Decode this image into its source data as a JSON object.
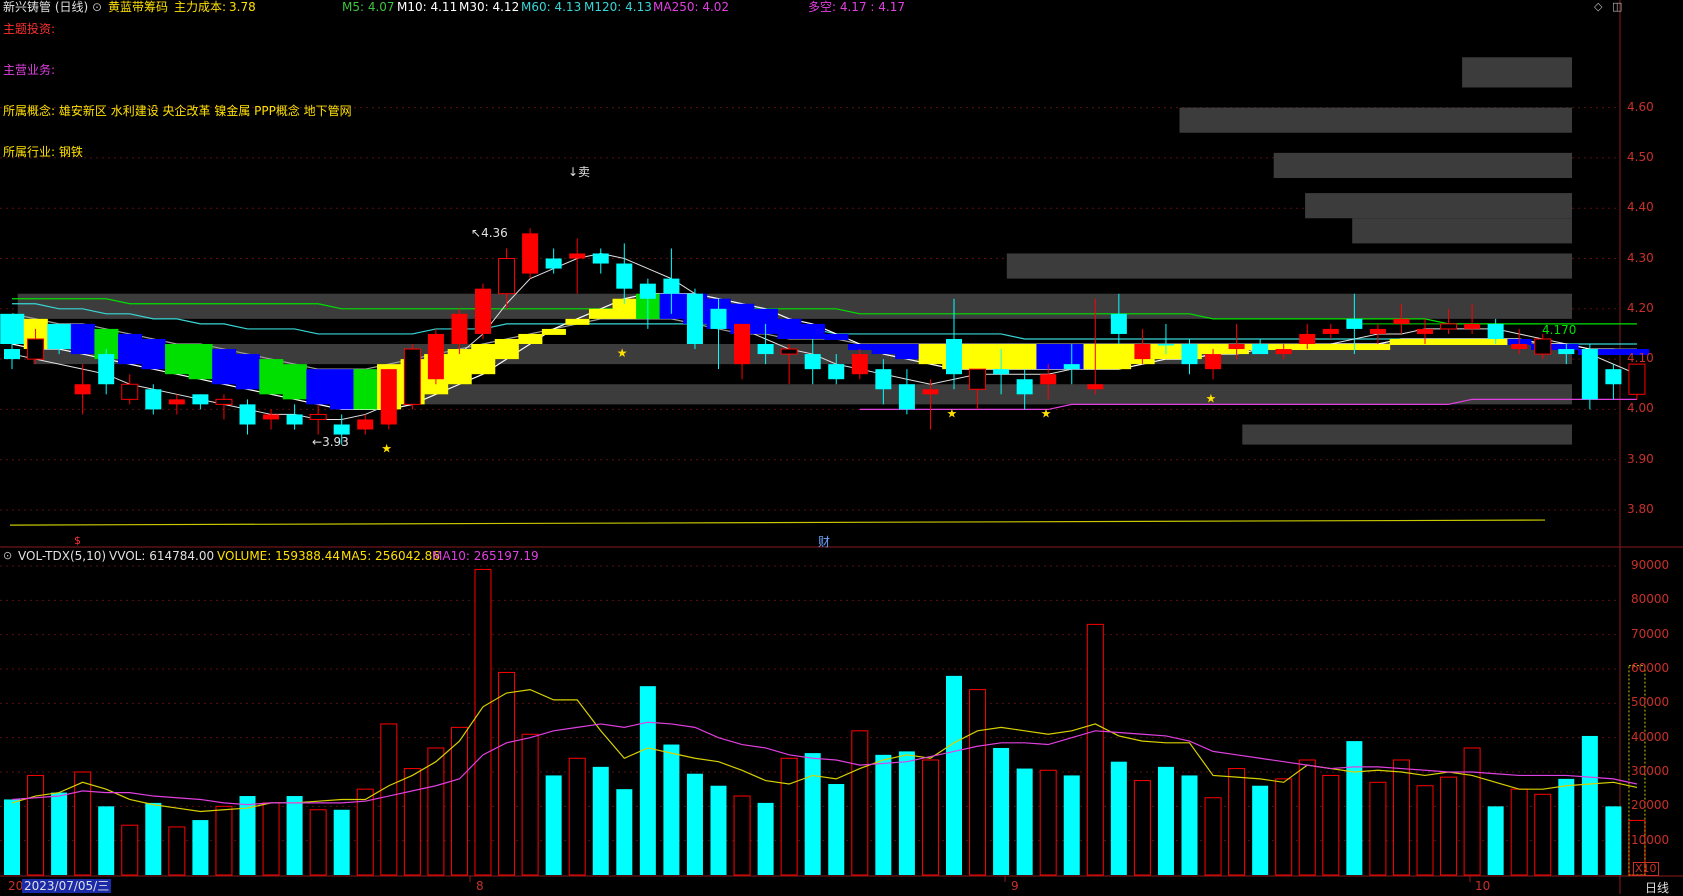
{
  "header": {
    "title": "新兴铸管 (日线)",
    "indicator_name": "黄蓝带筹码",
    "main_cost_label": "主力成本: ",
    "main_cost_value": "3.78",
    "ma": [
      {
        "label": "M5: 4.07",
        "color": "#3fc23f"
      },
      {
        "label": "M10: 4.11",
        "color": "#ffffff"
      },
      {
        "label": "M30: 4.12",
        "color": "#ffffff"
      },
      {
        "label": "M60: 4.13",
        "color": "#38d6d6"
      },
      {
        "label": "M120: 4.13",
        "color": "#38d6d6"
      },
      {
        "label": "MA250: 4.02",
        "color": "#e040e0"
      }
    ],
    "duokong": "多空: 4.17 : 4.17"
  },
  "info": {
    "theme_invest": "主题投资:",
    "main_business": "主营业务:",
    "concepts_label": "所属概念:",
    "concepts": "雄安新区 水利建设 央企改革 镍金属 PPP概念 地下管网",
    "industry_label": "所属行业:",
    "industry": "钢铁"
  },
  "annotations": {
    "high": "4.36",
    "low": "3.93",
    "sell": "↓卖",
    "last_line_value": "4.170",
    "finance_marker": "财",
    "dividend_marker": "$"
  },
  "volume_panel": {
    "name": "VOL-TDX(5,10)",
    "vvol": "VVOL: 614784.00",
    "volume": "VOLUME: 159388.44",
    "ma5": "MA5: 256042.86",
    "ma10": "MA10: 265197.19",
    "multiplier": "X10"
  },
  "footer": {
    "start_fragment": "20",
    "date": "2023/07/05/三",
    "month_8": "8",
    "month_9": "9",
    "month_10": "10",
    "period": "日线"
  },
  "colors": {
    "up": "#ff0000",
    "down": "#00ffff",
    "yellow": "#ffff00",
    "green": "#00e000",
    "blue": "#0000ff",
    "magenta": "#e040e0",
    "grid": "#5a1010",
    "axis_text": "#c8302a"
  },
  "chart_data": {
    "type": "candlestick",
    "price_axis": {
      "ticks": [
        3.8,
        3.9,
        4.0,
        4.1,
        4.2,
        4.3,
        4.4,
        4.5,
        4.6
      ],
      "ylim": [
        3.74,
        4.68
      ]
    },
    "volume_axis": {
      "ticks": [
        10000,
        20000,
        30000,
        40000,
        50000,
        60000,
        70000,
        80000,
        90000
      ],
      "ylim": [
        0,
        95000
      ],
      "multiplier": 10
    },
    "candles": [
      [
        4.12,
        4.13,
        4.08,
        4.1,
        "dn",
        22000
      ],
      [
        4.1,
        4.16,
        4.09,
        4.14,
        "up",
        29000
      ],
      [
        4.14,
        4.15,
        4.11,
        4.12,
        "dn",
        24000
      ],
      [
        4.05,
        4.09,
        3.99,
        4.03,
        "up",
        30000
      ],
      [
        4.11,
        4.12,
        4.03,
        4.05,
        "dn",
        20000
      ],
      [
        4.05,
        4.07,
        4.01,
        4.02,
        "up",
        14500
      ],
      [
        4.04,
        4.05,
        3.99,
        4.0,
        "dn",
        21000
      ],
      [
        4.01,
        4.03,
        3.99,
        4.02,
        "up",
        14000
      ],
      [
        4.03,
        4.03,
        4.0,
        4.01,
        "dn",
        16000
      ],
      [
        4.01,
        4.03,
        3.98,
        4.02,
        "up",
        20000
      ],
      [
        4.01,
        4.02,
        3.95,
        3.97,
        "dn",
        23000
      ],
      [
        3.98,
        4.0,
        3.96,
        3.99,
        "up",
        21000
      ],
      [
        3.99,
        4.01,
        3.96,
        3.97,
        "dn",
        23000
      ],
      [
        3.98,
        4.01,
        3.95,
        3.99,
        "up",
        19000
      ],
      [
        3.97,
        3.99,
        3.93,
        3.95,
        "dn",
        19000
      ],
      [
        3.96,
        3.99,
        3.95,
        3.98,
        "up",
        25000
      ],
      [
        3.97,
        4.08,
        3.96,
        4.08,
        "up",
        44000
      ],
      [
        4.01,
        4.13,
        4.0,
        4.12,
        "up",
        31000
      ],
      [
        4.06,
        4.16,
        4.05,
        4.15,
        "up",
        37000
      ],
      [
        4.13,
        4.2,
        4.11,
        4.19,
        "up",
        43000
      ],
      [
        4.15,
        4.25,
        4.14,
        4.24,
        "up",
        89000
      ],
      [
        4.23,
        4.32,
        4.2,
        4.3,
        "up",
        59000
      ],
      [
        4.27,
        4.36,
        4.26,
        4.35,
        "up",
        41000
      ],
      [
        4.3,
        4.32,
        4.27,
        4.28,
        "dn",
        29000
      ],
      [
        4.3,
        4.34,
        4.23,
        4.31,
        "up",
        34000
      ],
      [
        4.31,
        4.32,
        4.27,
        4.29,
        "dn",
        31500
      ],
      [
        4.29,
        4.33,
        4.21,
        4.24,
        "dn",
        25000
      ],
      [
        4.25,
        4.26,
        4.16,
        4.22,
        "dn",
        55000
      ],
      [
        4.26,
        4.32,
        4.19,
        4.23,
        "dn",
        38000
      ],
      [
        4.23,
        4.24,
        4.12,
        4.13,
        "dn",
        29500
      ],
      [
        4.2,
        4.22,
        4.08,
        4.16,
        "dn",
        26000
      ],
      [
        4.17,
        4.17,
        4.06,
        4.09,
        "up",
        23000
      ],
      [
        4.13,
        4.17,
        4.09,
        4.11,
        "dn",
        21000
      ],
      [
        4.11,
        4.13,
        4.05,
        4.12,
        "up",
        34000
      ],
      [
        4.11,
        4.14,
        4.05,
        4.08,
        "dn",
        35500
      ],
      [
        4.09,
        4.11,
        4.05,
        4.06,
        "dn",
        26500
      ],
      [
        4.11,
        4.12,
        4.06,
        4.07,
        "up",
        42000
      ],
      [
        4.08,
        4.1,
        4.01,
        4.04,
        "dn",
        35000
      ],
      [
        4.05,
        4.08,
        3.99,
        4.0,
        "dn",
        36000
      ],
      [
        4.03,
        4.06,
        3.96,
        4.04,
        "up",
        33500
      ],
      [
        4.07,
        4.22,
        4.04,
        4.14,
        "dn",
        58000
      ],
      [
        4.04,
        4.07,
        4.0,
        4.08,
        "up",
        54000
      ],
      [
        4.07,
        4.12,
        4.03,
        4.08,
        "dn",
        37000
      ],
      [
        4.06,
        4.08,
        4.0,
        4.03,
        "dn",
        31000
      ],
      [
        4.05,
        4.09,
        4.02,
        4.07,
        "up",
        30500
      ],
      [
        4.09,
        4.13,
        4.05,
        4.08,
        "dn",
        29000
      ],
      [
        4.04,
        4.22,
        4.03,
        4.05,
        "up",
        73000
      ],
      [
        4.15,
        4.23,
        4.13,
        4.19,
        "dn",
        33000
      ],
      [
        4.13,
        4.16,
        4.09,
        4.1,
        "up",
        27500
      ],
      [
        4.13,
        4.17,
        4.11,
        4.13,
        "dn",
        31500
      ],
      [
        4.09,
        4.14,
        4.07,
        4.13,
        "dn",
        29000
      ],
      [
        4.11,
        4.12,
        4.06,
        4.08,
        "up",
        22500
      ],
      [
        4.12,
        4.17,
        4.1,
        4.13,
        "up",
        31000
      ],
      [
        4.13,
        4.14,
        4.11,
        4.11,
        "dn",
        26000
      ],
      [
        4.11,
        4.13,
        4.1,
        4.12,
        "up",
        28000
      ],
      [
        4.13,
        4.17,
        4.12,
        4.15,
        "up",
        33500
      ],
      [
        4.16,
        4.17,
        4.14,
        4.15,
        "up",
        29000
      ],
      [
        4.18,
        4.23,
        4.11,
        4.16,
        "dn",
        39000
      ],
      [
        4.15,
        4.17,
        4.13,
        4.16,
        "up",
        27000
      ],
      [
        4.17,
        4.21,
        4.15,
        4.18,
        "up",
        33500
      ],
      [
        4.16,
        4.18,
        4.13,
        4.15,
        "up",
        26000
      ],
      [
        4.17,
        4.2,
        4.15,
        4.16,
        "up",
        28500
      ],
      [
        4.16,
        4.21,
        4.15,
        4.17,
        "up",
        37000
      ],
      [
        4.17,
        4.18,
        4.13,
        4.14,
        "dn",
        20000
      ],
      [
        4.13,
        4.16,
        4.11,
        4.12,
        "up",
        25000
      ],
      [
        4.14,
        4.15,
        4.1,
        4.11,
        "up",
        23500
      ],
      [
        4.12,
        4.13,
        4.09,
        4.11,
        "dn",
        28000
      ],
      [
        4.12,
        4.13,
        4.0,
        4.02,
        "dn",
        40500
      ],
      [
        4.08,
        4.09,
        4.02,
        4.05,
        "dn",
        20000
      ],
      [
        4.03,
        4.09,
        4.02,
        4.09,
        "up",
        15900
      ]
    ],
    "ribbon": [
      "c",
      "y",
      "c",
      "b",
      "g",
      "b",
      "b",
      "g",
      "g",
      "b",
      "b",
      "g",
      "g",
      "b",
      "b",
      "g",
      "y",
      "y",
      "y",
      "y",
      "y",
      "y",
      "y",
      "y",
      "y",
      "y",
      "y",
      "g",
      "b",
      "b",
      "b",
      "b",
      "b",
      "b",
      "b",
      "b",
      "b",
      "b",
      "b",
      "y",
      "y",
      "y",
      "y",
      "y",
      "b",
      "b",
      "y",
      "y",
      "y",
      "y",
      "y",
      "y",
      "y",
      "y",
      "y",
      "y",
      "y",
      "y",
      "y",
      "y",
      "y",
      "y",
      "y",
      "y",
      "b",
      "b",
      "b",
      "b",
      "b",
      "b"
    ],
    "ma5_price": [
      4.11,
      4.1,
      4.09,
      4.08,
      4.07,
      4.05,
      4.04,
      4.03,
      4.02,
      4.01,
      4.0,
      3.99,
      3.99,
      3.98,
      3.98,
      3.99,
      4.01,
      4.04,
      4.07,
      4.11,
      4.15,
      4.21,
      4.26,
      4.28,
      4.3,
      4.31,
      4.3,
      4.28,
      4.26,
      4.23,
      4.2,
      4.16,
      4.14,
      4.12,
      4.11,
      4.09,
      4.08,
      4.07,
      4.06,
      4.05,
      4.06,
      4.07,
      4.07,
      4.07,
      4.07,
      4.08,
      4.09,
      4.1,
      4.11,
      4.12,
      4.12,
      4.12,
      4.12,
      4.12,
      4.12,
      4.13,
      4.13,
      4.14,
      4.15,
      4.15,
      4.16,
      4.16,
      4.16,
      4.16,
      4.15,
      4.14,
      4.13,
      4.11,
      4.09,
      4.07
    ],
    "ma10_price": [
      4.13,
      4.12,
      4.12,
      4.11,
      4.1,
      4.09,
      4.08,
      4.07,
      4.06,
      4.05,
      4.04,
      4.03,
      4.02,
      4.01,
      4.0,
      4.0,
      4.0,
      4.01,
      4.03,
      4.05,
      4.07,
      4.1,
      4.13,
      4.16,
      4.18,
      4.2,
      4.22,
      4.23,
      4.23,
      4.23,
      4.22,
      4.21,
      4.2,
      4.18,
      4.17,
      4.15,
      4.13,
      4.11,
      4.1,
      4.09,
      4.08,
      4.08,
      4.08,
      4.08,
      4.08,
      4.08,
      4.08,
      4.08,
      4.09,
      4.1,
      4.1,
      4.11,
      4.11,
      4.12,
      4.12,
      4.12,
      4.13,
      4.13,
      4.13,
      4.14,
      4.14,
      4.14,
      4.14,
      4.14,
      4.14,
      4.13,
      4.13,
      4.12,
      4.12,
      4.11
    ],
    "ma30_price": [
      4.19,
      4.18,
      4.17,
      4.17,
      4.16,
      4.15,
      4.14,
      4.13,
      4.13,
      4.12,
      4.11,
      4.1,
      4.09,
      4.08,
      4.08,
      4.08,
      4.09,
      4.1,
      4.11,
      4.12,
      4.13,
      4.14,
      4.15,
      4.16,
      4.17,
      4.18,
      4.18,
      4.18,
      4.18,
      4.17,
      4.16,
      4.15,
      4.15,
      4.14,
      4.14,
      4.14,
      4.13,
      4.13,
      4.13,
      4.13,
      4.13,
      4.13,
      4.13,
      4.13,
      4.13,
      4.13,
      4.13,
      4.13,
      4.13,
      4.13,
      4.13,
      4.13,
      4.13,
      4.13,
      4.13,
      4.13,
      4.13,
      4.13,
      4.13,
      4.13,
      4.13,
      4.13,
      4.13,
      4.13,
      4.13,
      4.13,
      4.13,
      4.12,
      4.12,
      4.12
    ],
    "ma60_price": [
      4.21,
      4.21,
      4.2,
      4.2,
      4.19,
      4.19,
      4.18,
      4.18,
      4.17,
      4.17,
      4.16,
      4.16,
      4.16,
      4.15,
      4.15,
      4.15,
      4.15,
      4.15,
      4.16,
      4.16,
      4.16,
      4.17,
      4.17,
      4.17,
      4.17,
      4.17,
      4.17,
      4.17,
      4.17,
      4.17,
      4.17,
      4.16,
      4.16,
      4.16,
      4.16,
      4.15,
      4.15,
      4.15,
      4.15,
      4.15,
      4.15,
      4.15,
      4.15,
      4.14,
      4.14,
      4.14,
      4.14,
      4.14,
      4.14,
      4.14,
      4.14,
      4.14,
      4.14,
      4.14,
      4.14,
      4.14,
      4.14,
      4.14,
      4.14,
      4.14,
      4.14,
      4.14,
      4.14,
      4.14,
      4.14,
      4.13,
      4.13,
      4.13,
      4.13,
      4.13
    ],
    "ma120_price": [
      4.22,
      4.22,
      4.22,
      4.22,
      4.22,
      4.21,
      4.21,
      4.21,
      4.21,
      4.21,
      4.21,
      4.21,
      4.21,
      4.21,
      4.2,
      4.2,
      4.2,
      4.2,
      4.2,
      4.2,
      4.2,
      4.2,
      4.2,
      4.2,
      4.2,
      4.2,
      4.2,
      4.2,
      4.2,
      4.2,
      4.2,
      4.2,
      4.2,
      4.2,
      4.2,
      4.2,
      4.19,
      4.19,
      4.19,
      4.19,
      4.19,
      4.19,
      4.19,
      4.19,
      4.19,
      4.19,
      4.19,
      4.19,
      4.19,
      4.19,
      4.19,
      4.18,
      4.18,
      4.18,
      4.18,
      4.18,
      4.18,
      4.18,
      4.18,
      4.18,
      4.18,
      4.17,
      4.17,
      4.17,
      4.17,
      4.17,
      4.17,
      4.17,
      4.17,
      4.17
    ],
    "ma250_price": [
      4.0,
      4.0,
      4.0,
      4.0,
      4.0,
      4.0,
      4.0,
      4.0,
      4.0,
      4.0,
      4.0,
      4.0,
      4.0,
      4.0,
      4.0,
      4.0,
      4.0,
      4.0,
      4.0,
      4.0,
      4.0,
      4.0,
      4.0,
      4.0,
      4.0,
      4.0,
      4.0,
      4.0,
      4.0,
      4.0,
      4.0,
      4.0,
      4.0,
      4.0,
      4.0,
      4.0,
      4.0,
      4.0,
      4.0,
      4.0,
      4.0,
      4.0,
      4.0,
      4.0,
      4.0,
      4.01,
      4.01,
      4.01,
      4.01,
      4.01,
      4.01,
      4.01,
      4.01,
      4.01,
      4.01,
      4.01,
      4.01,
      4.01,
      4.01,
      4.01,
      4.01,
      4.01,
      4.02,
      4.02,
      4.02,
      4.02,
      4.02,
      4.02,
      4.02,
      4.02
    ],
    "main_cost_line": [
      3.77,
      3.78
    ],
    "vol_ma5": [
      21000,
      23000,
      24000,
      27000,
      25000,
      22000,
      20500,
      19500,
      18500,
      19000,
      19500,
      21000,
      21000,
      21500,
      22000,
      22000,
      26000,
      29000,
      33000,
      39000,
      49000,
      53000,
      54000,
      51000,
      51000,
      42000,
      34000,
      37000,
      35500,
      34000,
      33000,
      30500,
      27500,
      26500,
      29000,
      28000,
      31000,
      33500,
      35000,
      34000,
      38500,
      42000,
      43000,
      42000,
      41000,
      42000,
      44000,
      40500,
      39000,
      38500,
      38500,
      29000,
      28500,
      28000,
      27000,
      32000,
      31000,
      30000,
      30500,
      30000,
      29000,
      30000,
      29000,
      27000,
      25000,
      25000,
      26000,
      26500,
      27000,
      25500
    ],
    "vol_ma10": [
      22000,
      22500,
      23000,
      24500,
      24000,
      24000,
      23000,
      22500,
      22000,
      21000,
      20500,
      21000,
      21000,
      21000,
      21000,
      21500,
      23000,
      24500,
      26000,
      28000,
      35000,
      38500,
      40000,
      42000,
      43000,
      44000,
      43000,
      44500,
      44000,
      43000,
      40000,
      38000,
      37000,
      35000,
      34000,
      33500,
      32000,
      32500,
      33000,
      34500,
      36000,
      37500,
      38500,
      38500,
      38000,
      40000,
      42000,
      41500,
      41000,
      40500,
      39000,
      36000,
      35000,
      34000,
      33000,
      32000,
      31000,
      31500,
      31500,
      31000,
      30500,
      30000,
      30000,
      29500,
      29000,
      29000,
      29000,
      28500,
      28000,
      26500
    ],
    "chip_bars": [
      [
        4.64,
        4.7,
        0.07
      ],
      [
        4.55,
        4.6,
        0.25
      ],
      [
        4.46,
        4.51,
        0.19
      ],
      [
        4.38,
        4.43,
        0.17
      ],
      [
        4.33,
        4.38,
        0.14
      ],
      [
        4.26,
        4.31,
        0.36
      ],
      [
        4.18,
        4.23,
        0.99
      ],
      [
        4.09,
        4.13,
        0.98
      ],
      [
        4.01,
        4.05,
        0.75
      ],
      [
        3.93,
        3.97,
        0.21
      ]
    ]
  }
}
